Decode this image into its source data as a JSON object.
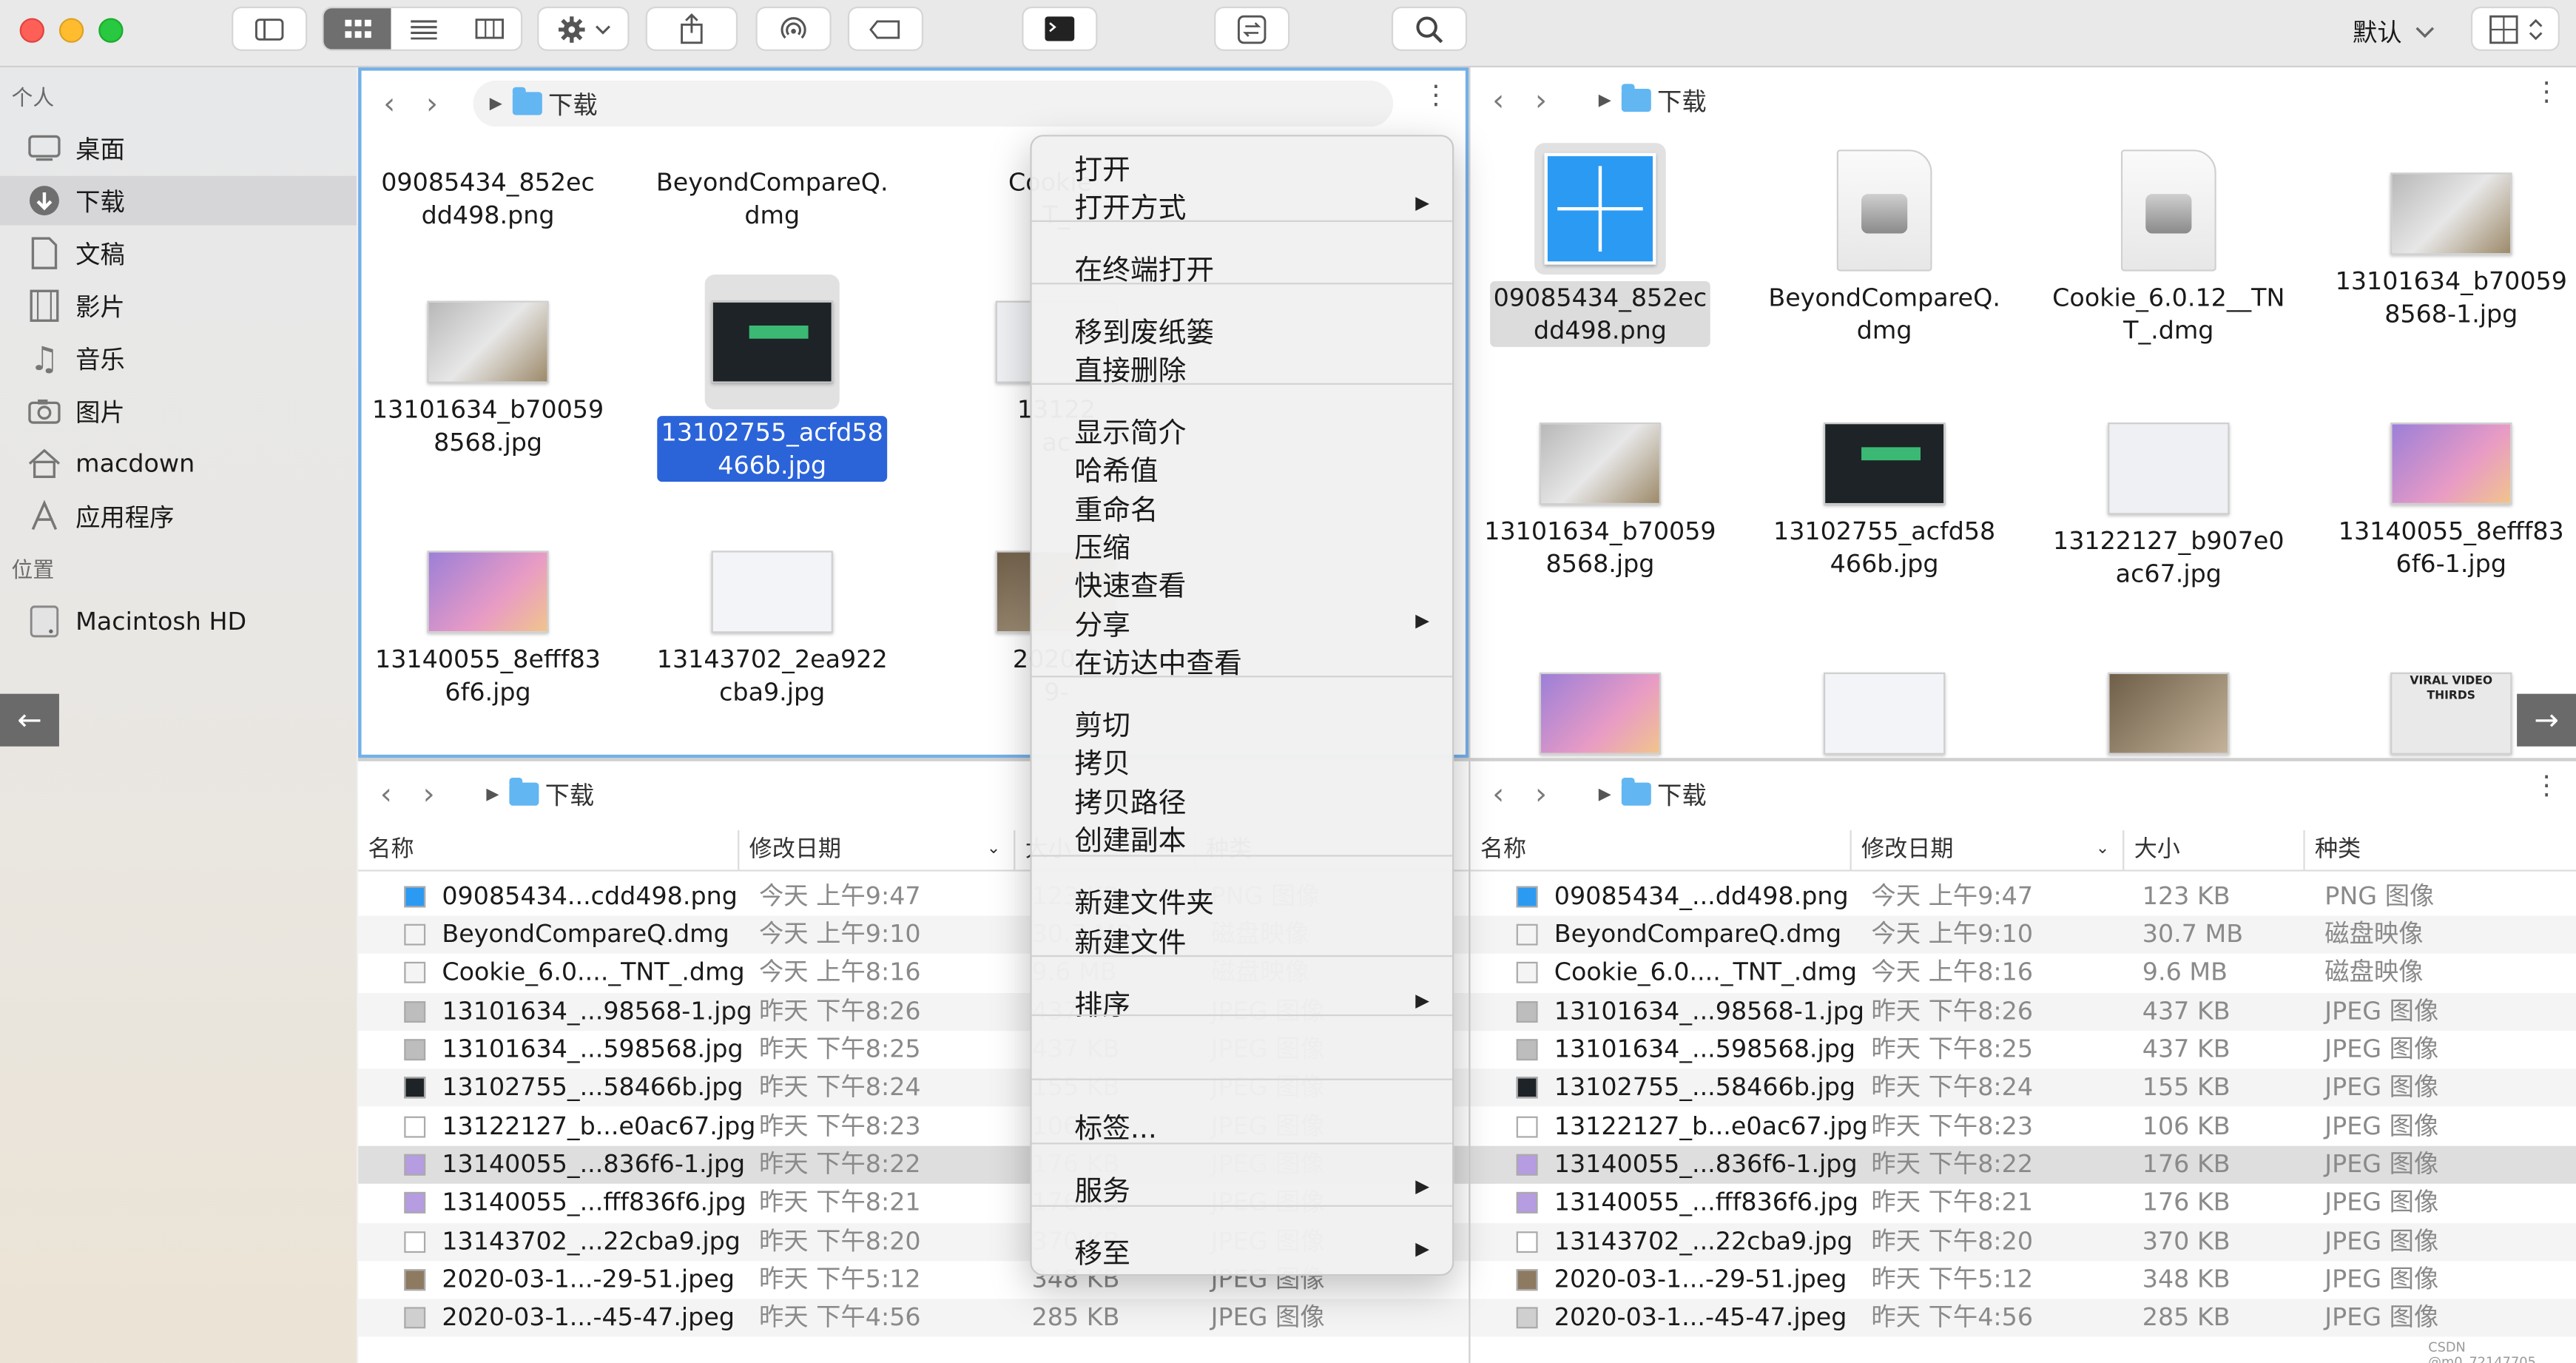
{
  "toolbar": {
    "view_label": "默认"
  },
  "sidebar": {
    "section_personal": "个人",
    "section_locations": "位置",
    "items": [
      {
        "label": "桌面",
        "icon": "desktop-icon"
      },
      {
        "label": "下载",
        "icon": "download-icon"
      },
      {
        "label": "文稿",
        "icon": "document-icon"
      },
      {
        "label": "影片",
        "icon": "film-icon"
      },
      {
        "label": "音乐",
        "icon": "music-icon"
      },
      {
        "label": "图片",
        "icon": "camera-icon"
      },
      {
        "label": "macdown",
        "icon": "home-icon"
      },
      {
        "label": "应用程序",
        "icon": "apps-icon"
      }
    ],
    "locations": [
      {
        "label": "Macintosh HD",
        "icon": "disk-icon"
      }
    ],
    "back_arrow": "←"
  },
  "panes": {
    "top_left": {
      "path": "下载",
      "row0": [
        "09085434_852ec\ndd498.png",
        "BeyondCompareQ.\ndmg",
        "Cookie_\nT_"
      ],
      "row1": [
        "13101634_b70059\n8568.jpg",
        "13102755_acfd58\n466b.jpg",
        "13122\nac"
      ],
      "row2": [
        "13140055_8efff83\n6f6.jpg",
        "13143702_2ea922\ncba9.jpg",
        "2020-0\n9-"
      ]
    },
    "top_right": {
      "path": "下载",
      "row0": [
        "09085434_852ec\ndd498.png",
        "BeyondCompareQ.\ndmg",
        "Cookie_6.0.12__TN\nT_.dmg",
        "13101634_b70059\n8568-1.jpg"
      ],
      "row1": [
        "13101634_b70059\n8568.jpg",
        "13102755_acfd58\n466b.jpg",
        "13122127_b907e0\nac67.jpg",
        "13140055_8efff83\n6f6-1.jpg"
      ],
      "partial_thumb_text": "VIRAL VIDEO THIRDS",
      "right_arrow": "→"
    },
    "bottom_left": {
      "path": "下载"
    },
    "bottom_right": {
      "path": "下载"
    }
  },
  "list": {
    "headers": {
      "name": "名称",
      "date": "修改日期",
      "size": "大小",
      "kind": "种类"
    },
    "rows": [
      {
        "name": "09085434_...dd498.png",
        "name_left": "09085434...cdd498.png",
        "date": "今天 上午9:47",
        "size": "123 KB",
        "kind": "PNG 图像"
      },
      {
        "name": "BeyondCompareQ.dmg",
        "name_left": "BeyondCompareQ.dmg",
        "date": "今天 上午9:10",
        "size": "30.7 MB",
        "kind": "磁盘映像"
      },
      {
        "name": "Cookie_6.0...._TNT_.dmg",
        "name_left": "Cookie_6.0...._TNT_.dmg",
        "date": "今天 上午8:16",
        "size": "9.6 MB",
        "kind": "磁盘映像"
      },
      {
        "name": "13101634_...98568-1.jpg",
        "name_left": "13101634_...98568-1.jpg",
        "date": "昨天 下午8:26",
        "size": "437 KB",
        "kind": "JPEG 图像"
      },
      {
        "name": "13101634_...598568.jpg",
        "name_left": "13101634_...598568.jpg",
        "date": "昨天 下午8:25",
        "size": "437 KB",
        "kind": "JPEG 图像"
      },
      {
        "name": "13102755_...58466b.jpg",
        "name_left": "13102755_...58466b.jpg",
        "date": "昨天 下午8:24",
        "size": "155 KB",
        "kind": "JPEG 图像"
      },
      {
        "name": "13122127_b...e0ac67.jpg",
        "name_left": "13122127_b...e0ac67.jpg",
        "date": "昨天 下午8:23",
        "size": "106 KB",
        "kind": "JPEG 图像"
      },
      {
        "name": "13140055_...836f6-1.jpg",
        "name_left": "13140055_...836f6-1.jpg",
        "date": "昨天 下午8:22",
        "size": "176 KB",
        "kind": "JPEG 图像"
      },
      {
        "name": "13140055_...fff836f6.jpg",
        "name_left": "13140055_...fff836f6.jpg",
        "date": "昨天 下午8:21",
        "size": "176 KB",
        "kind": "JPEG 图像"
      },
      {
        "name": "13143702_...22cba9.jpg",
        "name_left": "13143702_...22cba9.jpg",
        "date": "昨天 下午8:20",
        "size": "370 KB",
        "kind": "JPEG 图像"
      },
      {
        "name": "2020-03-1...-29-51.jpeg",
        "name_left": "2020-03-1...-29-51.jpeg",
        "date": "昨天 下午5:12",
        "size": "348 KB",
        "kind": "JPEG 图像"
      },
      {
        "name": "2020-03-1...-45-47.jpeg",
        "name_left": "2020-03-1...-45-47.jpeg",
        "date": "昨天 下午4:56",
        "size": "285 KB",
        "kind": "JPEG 图像"
      }
    ]
  },
  "context_menu": {
    "items": [
      "打开",
      "打开方式",
      "在终端打开",
      "移到废纸篓",
      "直接删除",
      "显示简介",
      "哈希值",
      "重命名",
      "压缩",
      "快速查看",
      "分享",
      "在访达中查看",
      "剪切",
      "拷贝",
      "拷贝路径",
      "创建副本",
      "新建文件夹",
      "新建文件",
      "排序",
      "标签...",
      "服务",
      "移至"
    ],
    "submenu_arrow": "▶"
  },
  "watermark": "CSDN @m0_72147705",
  "colors": {
    "accent": "#2b63d9",
    "folder": "#62b6f2",
    "selection_gray": "#dedede"
  }
}
